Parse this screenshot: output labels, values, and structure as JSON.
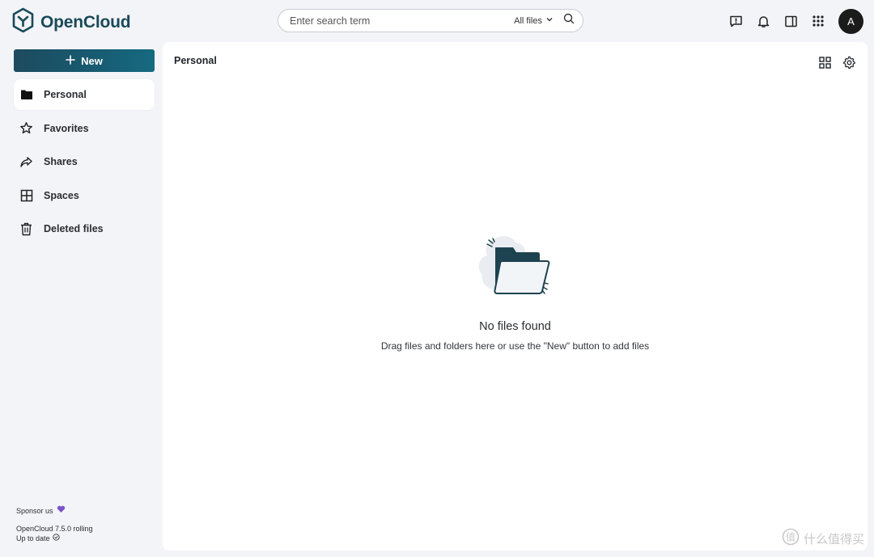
{
  "app": {
    "name": "OpenCloud"
  },
  "search": {
    "placeholder": "Enter search term",
    "scope": "All files"
  },
  "user": {
    "avatar_initial": "A"
  },
  "sidebar": {
    "new_label": "New",
    "items": [
      {
        "label": "Personal",
        "icon": "folder-icon",
        "active": true
      },
      {
        "label": "Favorites",
        "icon": "star-icon"
      },
      {
        "label": "Shares",
        "icon": "share-arrow-icon"
      },
      {
        "label": "Spaces",
        "icon": "spaces-grid-icon"
      },
      {
        "label": "Deleted files",
        "icon": "trash-icon"
      }
    ],
    "footer": {
      "sponsor": "Sponsor us",
      "version": "OpenCloud 7.5.0 rolling",
      "status": "Up to date"
    }
  },
  "main": {
    "breadcrumb": "Personal",
    "empty_title": "No files found",
    "empty_desc": "Drag files and folders here or use the \"New\" button to add files"
  },
  "watermark": {
    "text": "什么值得买"
  },
  "colors": {
    "accent": "#1a4a5a",
    "new_button": "#175c72",
    "background": "#f3f4f7",
    "heart": "#7b52c9"
  }
}
